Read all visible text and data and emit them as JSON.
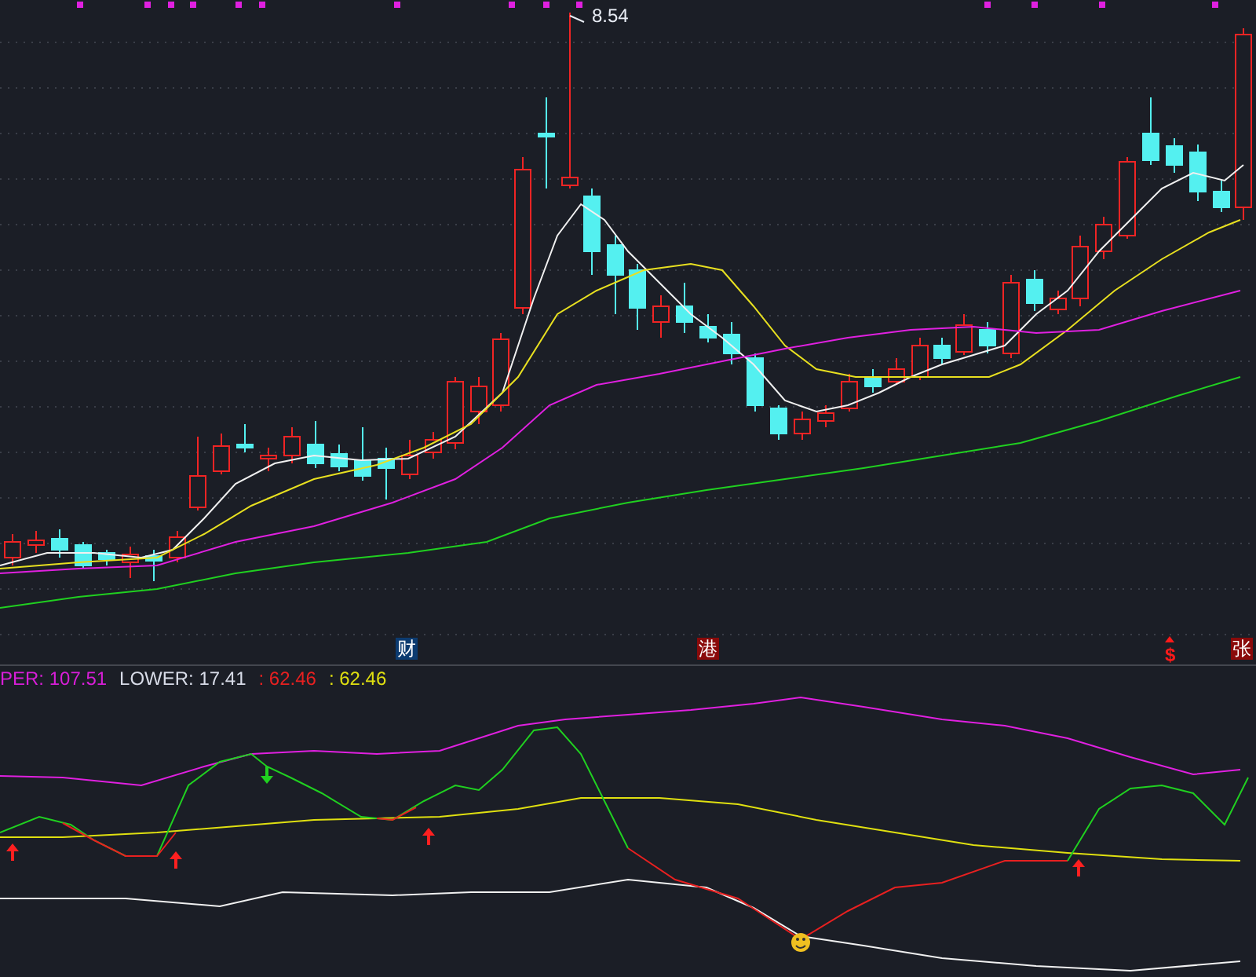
{
  "main_chart": {
    "peak_label": "8.54",
    "event_badges": [
      {
        "text": "财",
        "kind": "finance"
      },
      {
        "text": "港",
        "kind": "hk"
      },
      {
        "text": "$",
        "kind": "dollar"
      },
      {
        "text": "张",
        "kind": "notice"
      }
    ]
  },
  "indicator": {
    "legend": [
      {
        "text": "PER: 107.51",
        "color": "#d81ed8"
      },
      {
        "text": "LOWER: 17.41",
        "color": "#d8dce8"
      },
      {
        "text": ": 62.46",
        "color": "#e82020"
      },
      {
        "text": ": 62.46",
        "color": "#e0e010"
      }
    ]
  }
}
